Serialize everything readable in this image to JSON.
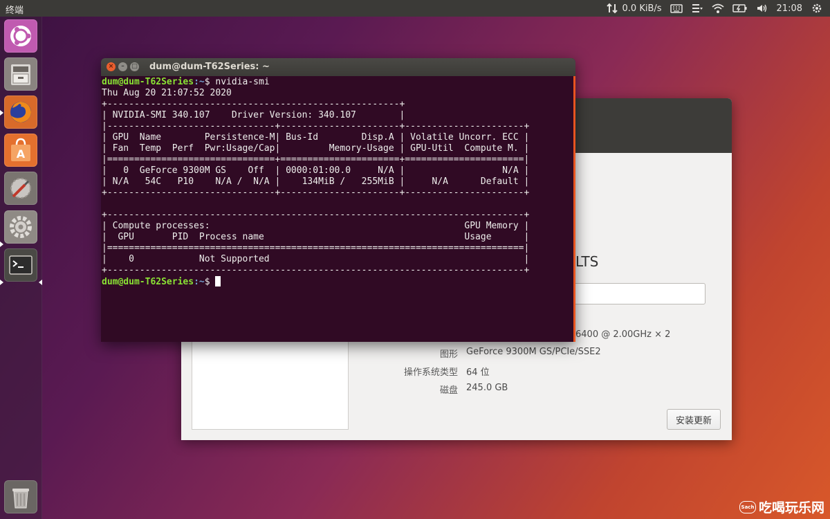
{
  "topbar": {
    "app_title": "终端",
    "network_speed": "0.0 KiB/s",
    "time": "21:08",
    "icons": [
      "network-transfer-icon",
      "keyboard-icon",
      "menu-icon",
      "wifi-icon",
      "battery-icon",
      "volume-icon",
      "gear-icon"
    ]
  },
  "launcher": {
    "items": [
      "ubuntu-dash",
      "files",
      "firefox",
      "software-center",
      "system-tools",
      "system-settings",
      "terminal"
    ],
    "trash": "trash"
  },
  "terminal": {
    "title": "dum@dum-T62Series: ~",
    "prompt_user": "dum@dum-T62Series",
    "prompt_path": ":~",
    "prompt_symbol": "$ ",
    "command": "nvidia-smi",
    "output_lines": [
      "Thu Aug 20 21:07:52 2020",
      "+------------------------------------------------------+",
      "| NVIDIA-SMI 340.107    Driver Version: 340.107        |",
      "|-------------------------------+----------------------+----------------------+",
      "| GPU  Name        Persistence-M| Bus-Id        Disp.A | Volatile Uncorr. ECC |",
      "| Fan  Temp  Perf  Pwr:Usage/Cap|         Memory-Usage | GPU-Util  Compute M. |",
      "|===============================+======================+======================|",
      "|   0  GeForce 9300M GS    Off  | 0000:01:00.0     N/A |                  N/A |",
      "| N/A   54C   P10    N/A /  N/A |    134MiB /   255MiB |     N/A      Default |",
      "+-------------------------------+----------------------+----------------------+",
      "",
      "+-----------------------------------------------------------------------------+",
      "| Compute processes:                                               GPU Memory |",
      "|  GPU       PID  Process name                                     Usage      |",
      "|=============================================================================|",
      "|    0            Not Supported                                               |",
      "+-----------------------------------------------------------------------------+"
    ]
  },
  "settings": {
    "os_name_partial": "LTS",
    "processor_partial": "6400 @ 2.00GHz × 2",
    "graphics_label": "图形",
    "graphics_value": "GeForce 9300M GS/PCIe/SSE2",
    "ostype_label": "操作系统类型",
    "ostype_value": "64 位",
    "disk_label": "磁盘",
    "disk_value": "245.0 GB",
    "update_button": "安装更新"
  },
  "watermark": {
    "bubble": "Sach",
    "text": "吃喝玩乐网"
  }
}
